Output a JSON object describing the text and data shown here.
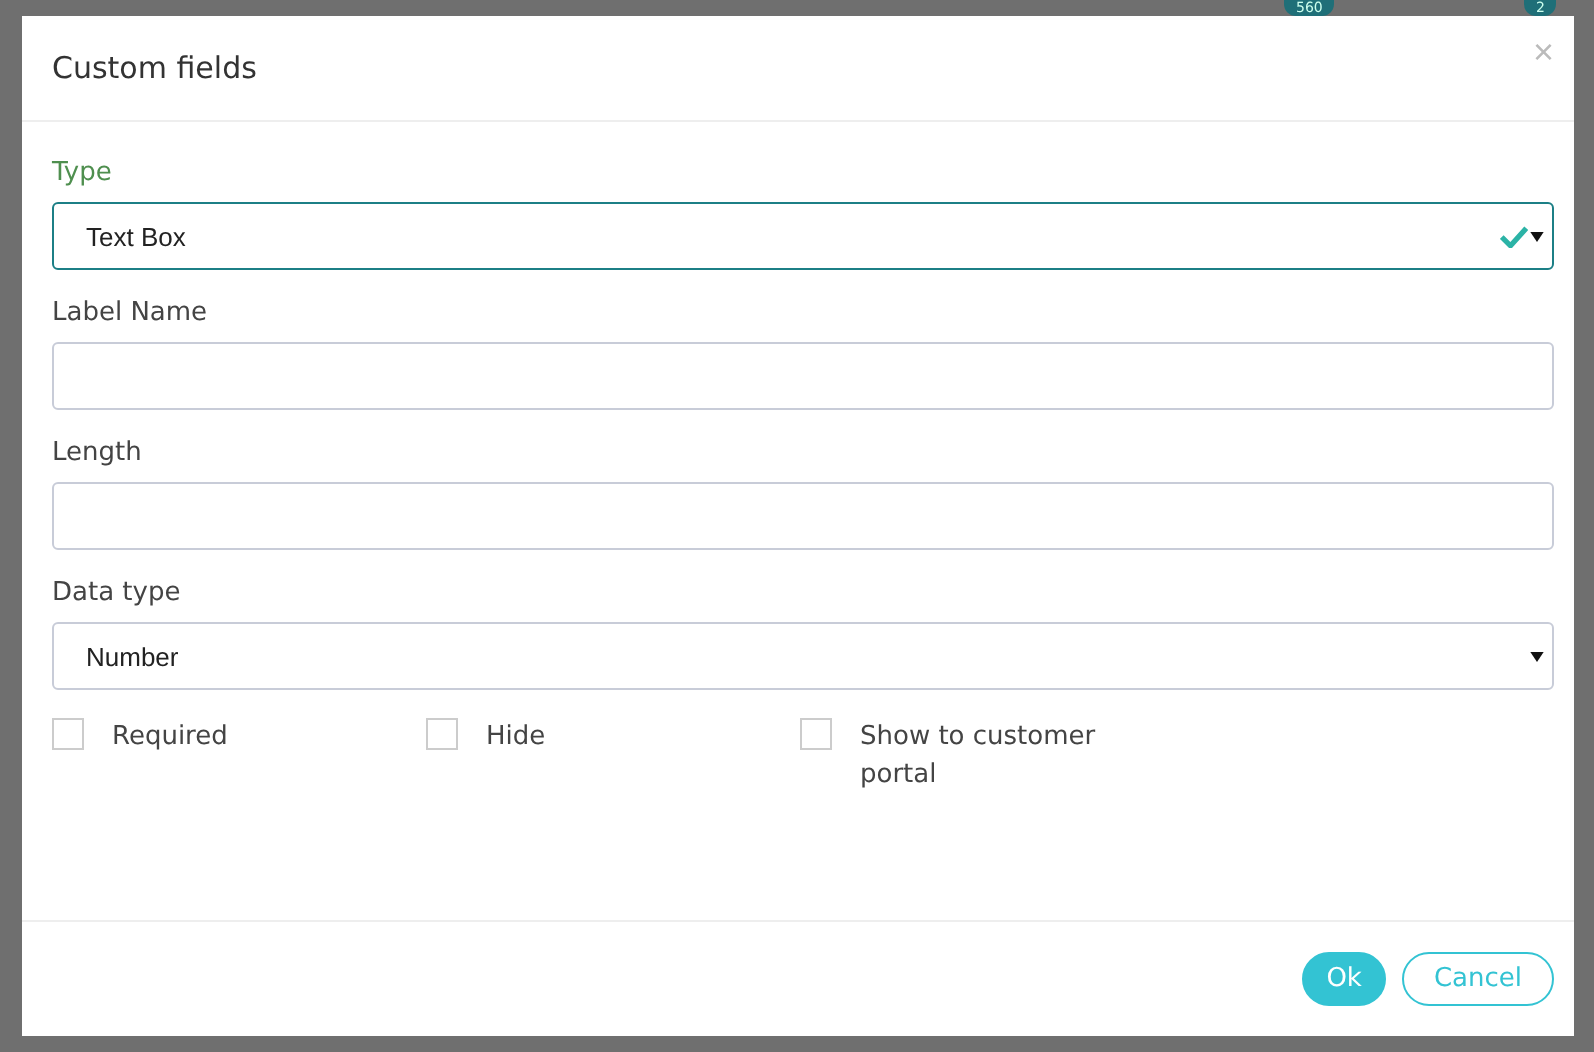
{
  "background": {
    "badges": [
      "560",
      "2"
    ]
  },
  "dialog": {
    "title": "Custom fields",
    "close": "×",
    "fields": [
      {
        "kind": "select",
        "label": "Type",
        "value": "Text Box",
        "valid": true
      },
      {
        "kind": "text",
        "label": "Label Name"
      },
      {
        "kind": "text",
        "label": "Length"
      },
      {
        "kind": "select",
        "label": "Data type",
        "value": "Number",
        "valid": false
      }
    ],
    "checkboxes": [
      {
        "label": "Required",
        "checked": false
      },
      {
        "label": "Hide",
        "checked": false
      },
      {
        "label": "Show to customer portal",
        "checked": false
      }
    ],
    "buttons": [
      {
        "label": "Ok",
        "kind": "primary"
      },
      {
        "label": "Cancel",
        "kind": "secondary"
      }
    ]
  }
}
